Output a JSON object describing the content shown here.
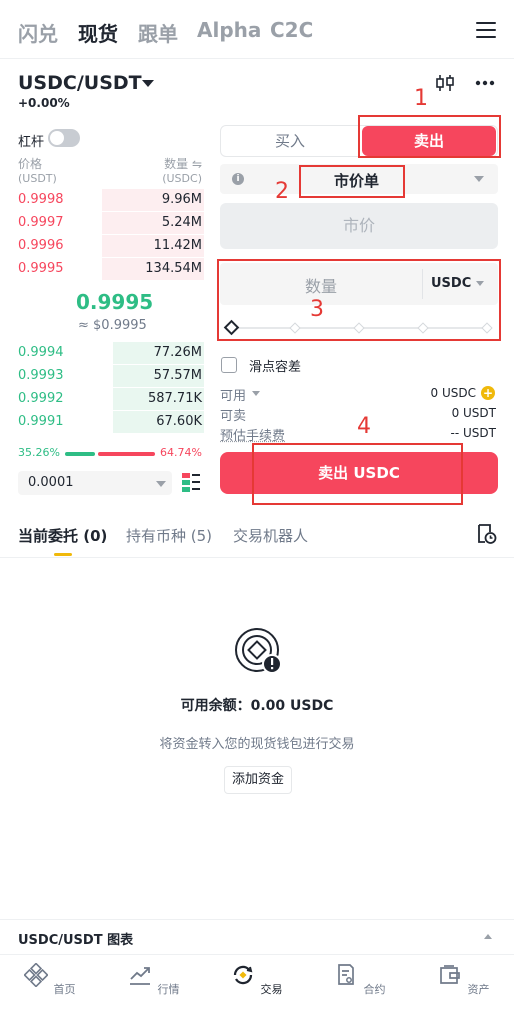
{
  "topnav": {
    "tabs": [
      "闪兑",
      "现货",
      "跟单",
      "Alpha",
      "C2C"
    ],
    "active_index": 1
  },
  "pair": {
    "symbol": "USDC/USDT",
    "change": "+0.00%"
  },
  "leverage": {
    "label": "杠杆",
    "enabled": false
  },
  "orderbook": {
    "price_header": "价格",
    "price_unit": "(USDT)",
    "qty_header": "数量 ⇋",
    "qty_unit": "(USDC)",
    "asks": [
      {
        "price": "0.9998",
        "qty": "9.96M",
        "depth": 0.55
      },
      {
        "price": "0.9997",
        "qty": "5.24M",
        "depth": 0.55
      },
      {
        "price": "0.9996",
        "qty": "11.42M",
        "depth": 0.55
      },
      {
        "price": "0.9995",
        "qty": "134.54M",
        "depth": 0.55
      }
    ],
    "mid_price": "0.9995",
    "mid_fiat": "≈ $0.9995",
    "bids": [
      {
        "price": "0.9994",
        "qty": "77.26M",
        "depth": 0.49
      },
      {
        "price": "0.9993",
        "qty": "57.57M",
        "depth": 0.49
      },
      {
        "price": "0.9992",
        "qty": "587.71K",
        "depth": 0.49
      },
      {
        "price": "0.9991",
        "qty": "67.60K",
        "depth": 0.49
      }
    ],
    "buy_ratio": "35.26%",
    "sell_ratio": "64.74%",
    "precision": "0.0001"
  },
  "trade": {
    "buy_label": "买入",
    "sell_label": "卖出",
    "order_type": "市价单",
    "price_placeholder": "市价",
    "qty_placeholder": "数量",
    "qty_unit": "USDC",
    "slippage_label": "滑点容差",
    "available_label": "可用",
    "available_value": "0 USDC",
    "sellable_label": "可卖",
    "sellable_value": "0 USDT",
    "fee_label": "预估手续费",
    "fee_value": "-- USDT",
    "submit_label": "卖出 USDC"
  },
  "annotations": [
    "1",
    "2",
    "3",
    "4"
  ],
  "bottom_tabs": [
    "当前委托 (0)",
    "持有币种 (5)",
    "交易机器人"
  ],
  "empty_state": {
    "title": "可用余额：0.00 USDC",
    "subtitle": "将资金转入您的现货钱包进行交易",
    "button": "添加资金"
  },
  "chart_bar": {
    "label": "USDC/USDT 图表"
  },
  "navbar": {
    "items": [
      {
        "label": "首页",
        "icon": "home-icon"
      },
      {
        "label": "行情",
        "icon": "markets-icon"
      },
      {
        "label": "交易",
        "icon": "trade-icon"
      },
      {
        "label": "合约",
        "icon": "futures-icon"
      },
      {
        "label": "资产",
        "icon": "wallet-icon"
      }
    ],
    "active_index": 2
  },
  "colors": {
    "sell": "#f6465d",
    "buy": "#2ebd85",
    "accent": "#f0b90b",
    "annotation": "#e53935"
  }
}
